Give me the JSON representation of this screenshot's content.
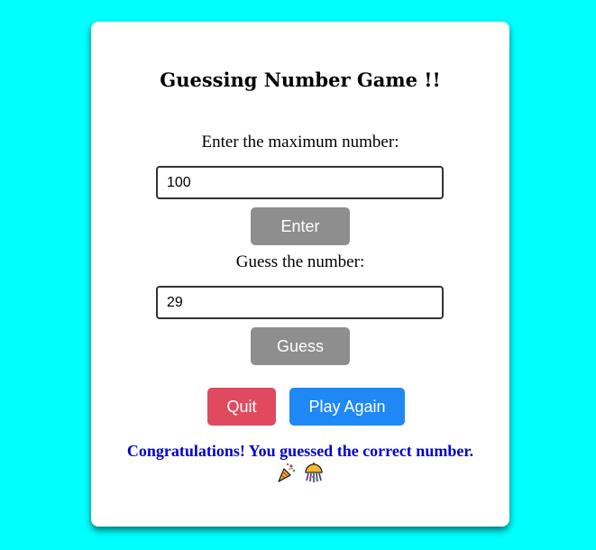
{
  "game": {
    "title": "Guessing Number Game !!",
    "max_label": "Enter the maximum number:",
    "max_value": "100",
    "enter_button": "Enter",
    "guess_label": "Guess the number:",
    "guess_value": "29",
    "guess_button": "Guess",
    "quit_button": "Quit",
    "play_again_button": "Play Again",
    "message": "Congratulations! You guessed the correct number.",
    "message_icons": [
      "party-popper-icon",
      "confetti-ball-icon"
    ]
  },
  "colors": {
    "background": "#00ffff",
    "card": "#ffffff",
    "gray_button": "#8e8e8e",
    "quit_button": "#e04a5e",
    "play_again_button": "#1e88f5",
    "message": "#0000cc"
  }
}
